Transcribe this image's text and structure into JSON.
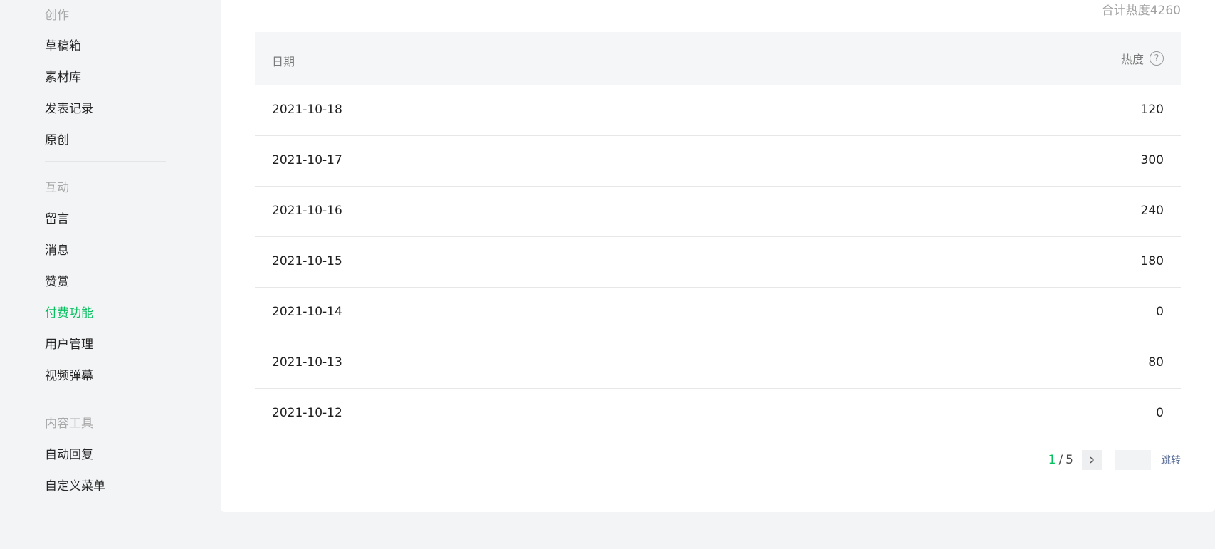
{
  "sidebar": {
    "group_create": "创作",
    "drafts": "草稿箱",
    "materials": "素材库",
    "publish_records": "发表记录",
    "original": "原创",
    "group_interact": "互动",
    "comments": "留言",
    "messages": "消息",
    "rewards": "赞赏",
    "paid_features": "付费功能",
    "user_management": "用户管理",
    "video_danmaku": "视频弹幕",
    "group_tools": "内容工具",
    "auto_reply": "自动回复",
    "custom_menu": "自定义菜单"
  },
  "summary": "合计热度4260",
  "table": {
    "header_date": "日期",
    "header_heat": "热度",
    "rows": [
      {
        "date": "2021-10-18",
        "value": "120"
      },
      {
        "date": "2021-10-17",
        "value": "300"
      },
      {
        "date": "2021-10-16",
        "value": "240"
      },
      {
        "date": "2021-10-15",
        "value": "180"
      },
      {
        "date": "2021-10-14",
        "value": "0"
      },
      {
        "date": "2021-10-13",
        "value": "80"
      },
      {
        "date": "2021-10-12",
        "value": "0"
      }
    ]
  },
  "pager": {
    "current": "1",
    "separator": "/",
    "total": "5",
    "jump_value": "",
    "jump_label": "跳转"
  },
  "colors": {
    "accent": "#07c160",
    "link": "#576b95"
  }
}
